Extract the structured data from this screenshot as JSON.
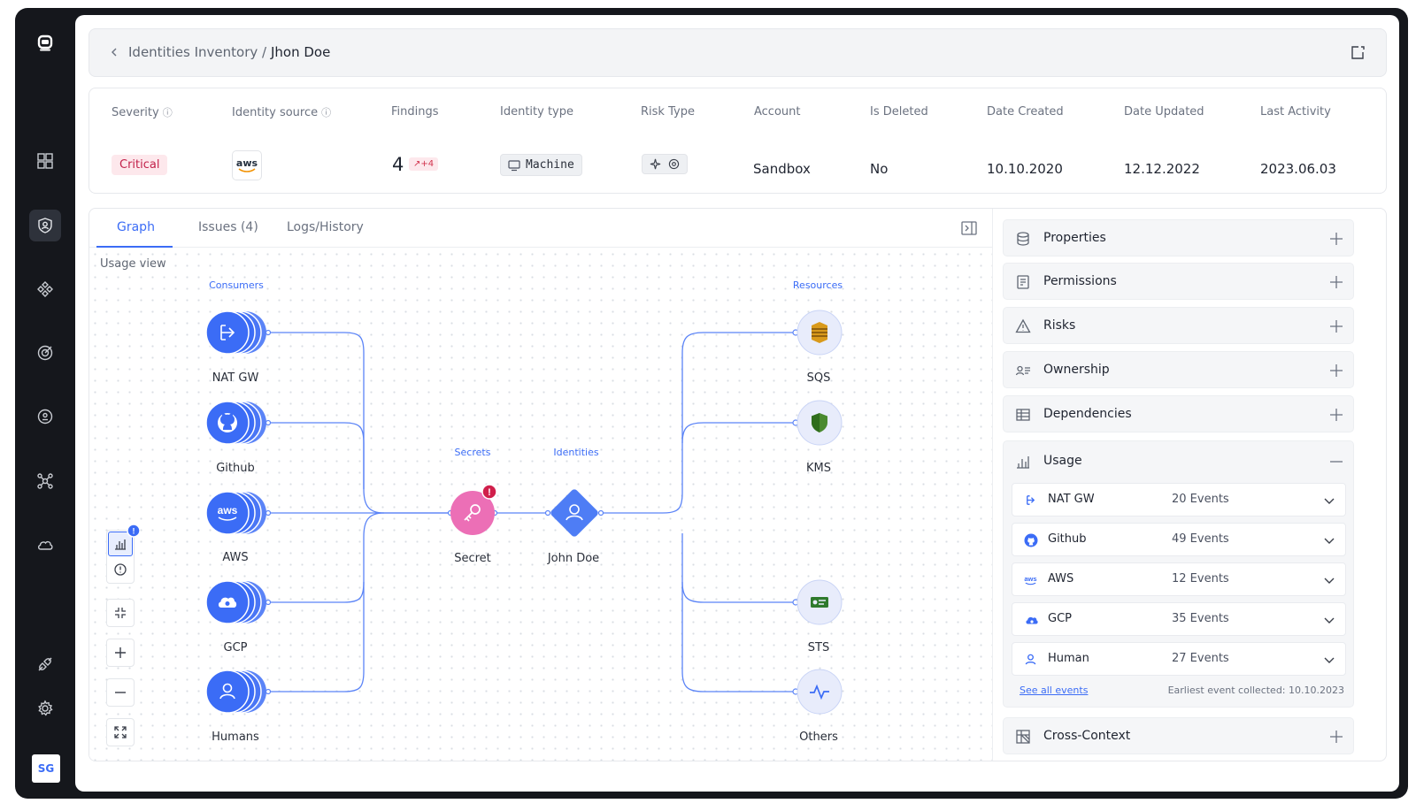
{
  "sidebar": {
    "items": [
      "logo-icon",
      "dashboard-icon",
      "identities-icon",
      "integrations-icon",
      "target-icon",
      "vault-icon",
      "network-icon",
      "cloud-icon",
      "plugin-icon",
      "settings-icon"
    ],
    "avatar_initials": "SG"
  },
  "breadcrumb": {
    "parent": "Identities Inventory /",
    "current": "Jhon Doe"
  },
  "summary": {
    "severity": {
      "label": "Severity",
      "value": "Critical"
    },
    "identity_source": {
      "label": "Identity source",
      "value": "aws"
    },
    "findings": {
      "label": "Findings",
      "value": "4",
      "delta": "↗+4"
    },
    "identity_type": {
      "label": "Identity type",
      "value": "Machine"
    },
    "risk_type": {
      "label": "Risk Type"
    },
    "account": {
      "label": "Account",
      "value": "Sandbox"
    },
    "is_deleted": {
      "label": "Is Deleted",
      "value": "No"
    },
    "date_created": {
      "label": "Date Created",
      "value": "10.10.2020"
    },
    "date_updated": {
      "label": "Date Updated",
      "value": "12.12.2022"
    },
    "last_activity": {
      "label": "Last Activity",
      "value": "2023.06.03"
    }
  },
  "tabs": [
    {
      "label": "Graph",
      "active": true
    },
    {
      "label": "Issues (4)"
    },
    {
      "label": "Logs/History"
    }
  ],
  "graph": {
    "view_label": "Usage view",
    "groups": {
      "consumers": "Consumers",
      "secrets": "Secrets",
      "identities": "Identities",
      "resources": "Resources"
    },
    "consumers": [
      "NAT GW",
      "Github",
      "AWS",
      "GCP",
      "Humans"
    ],
    "secret": "Secret",
    "identity": "John Doe",
    "resources": [
      "SQS",
      "KMS",
      "STS",
      "Others"
    ],
    "colors": {
      "accent": "#3b6cf6",
      "secret": "#ec6fb6",
      "alert": "#d01f4b"
    }
  },
  "panel": {
    "sections": [
      "Properties",
      "Permissions",
      "Risks",
      "Ownership",
      "Dependencies"
    ],
    "usage": {
      "title": "Usage",
      "rows": [
        {
          "name": "NAT GW",
          "events": "20 Events",
          "icon": "nat-gateway-icon"
        },
        {
          "name": "Github",
          "events": "49 Events",
          "icon": "github-icon"
        },
        {
          "name": "AWS",
          "events": "12 Events",
          "icon": "aws-icon"
        },
        {
          "name": "GCP",
          "events": "35 Events",
          "icon": "gcp-icon"
        },
        {
          "name": "Human",
          "events": "27 Events",
          "icon": "user-icon"
        }
      ],
      "see_all": "See all events",
      "earliest": "Earliest event collected: 10.10.2023"
    },
    "cross_context": "Cross-Context"
  }
}
